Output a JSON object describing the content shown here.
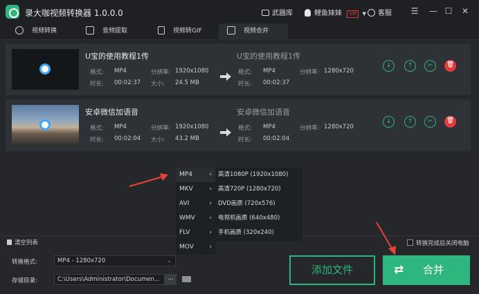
{
  "app": {
    "title": "录大咖视频转换器 1.0.0.0"
  },
  "titlebar": {
    "store": "武器库",
    "user": "鲤鱼妹妹",
    "vip": "VIP",
    "service": "客服"
  },
  "tabs": [
    {
      "label": "视频转换",
      "icon": "convert-icon"
    },
    {
      "label": "音频提取",
      "icon": "radio-icon"
    },
    {
      "label": "视频转GIF",
      "icon": "gif-file-icon"
    },
    {
      "label": "视频合并",
      "icon": "merge-icon",
      "active": true
    }
  ],
  "labels": {
    "format": "格式:",
    "resolution": "分辨率:",
    "duration": "时长:",
    "size": "大小:"
  },
  "files": [
    {
      "name": "U宝的使用教程1传",
      "src_format": "MP4",
      "src_res": "1920x1080",
      "src_dur": "00:02:37",
      "src_size": "24.5 MB",
      "out_name": "U宝的使用教程1传",
      "out_format": "MP4",
      "out_res": "1280x720",
      "out_dur": "00:02:37",
      "thumb": "dark"
    },
    {
      "name": "安卓微信加语音",
      "src_format": "MP4",
      "src_res": "1920x1080",
      "src_dur": "00:02:04",
      "src_size": "43.2 MB",
      "out_name": "安卓微信加语音",
      "out_format": "MP4",
      "out_res": "1280x720",
      "out_dur": "00:02:04",
      "thumb": "beach"
    }
  ],
  "menu": {
    "formats": [
      "MP4",
      "MKV",
      "AVI",
      "WMV",
      "FLV",
      "MOV"
    ],
    "selected": "MP4",
    "qualities": [
      "高清1080P (1920x1080)",
      "高清720P (1280x720)",
      "DVD画质 (720x576)",
      "电视机画质 (640x480)",
      "手机画质 (320x240)"
    ]
  },
  "bottom": {
    "clear_list": "清空列表",
    "shutdown_label": "转换完成后关闭电脑",
    "format_label": "转换格式:",
    "format_value": "MP4 - 1280x720",
    "dir_label": "存储目录:",
    "dir_value": "C:\\Users\\Administrator\\Documen...",
    "browse": "...",
    "add_file": "添加文件",
    "merge": "合并"
  },
  "colors": {
    "accent": "#2fb57e",
    "delete": "#e13b3b",
    "annotation": "#e8433a"
  }
}
